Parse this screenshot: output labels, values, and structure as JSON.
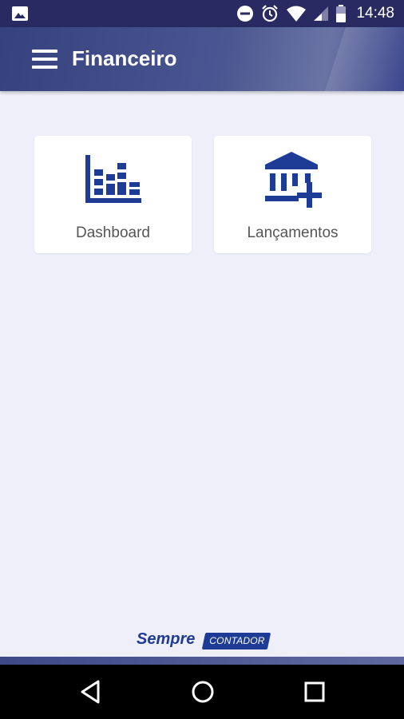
{
  "status_bar": {
    "time": "14:48",
    "icons": [
      "gallery-notification-icon",
      "do-not-disturb-icon",
      "alarm-icon",
      "wifi-icon",
      "signal-icon",
      "battery-icon"
    ]
  },
  "app_bar": {
    "title": "Financeiro",
    "menu_icon": "hamburger-menu-icon"
  },
  "tiles": [
    {
      "label": "Dashboard",
      "icon": "bar-chart-icon"
    },
    {
      "label": "Lançamentos",
      "icon": "bank-add-icon"
    }
  ],
  "branding": {
    "sempre": "Sempre",
    "contador": "CONTADOR"
  },
  "nav_bar": {
    "buttons": [
      "back-icon",
      "home-icon",
      "recent-apps-icon"
    ]
  },
  "colors": {
    "accent": "#1e3c96",
    "app_bar": "#4a5690",
    "status_bar": "#2a2a63",
    "background": "#eeeff9"
  }
}
